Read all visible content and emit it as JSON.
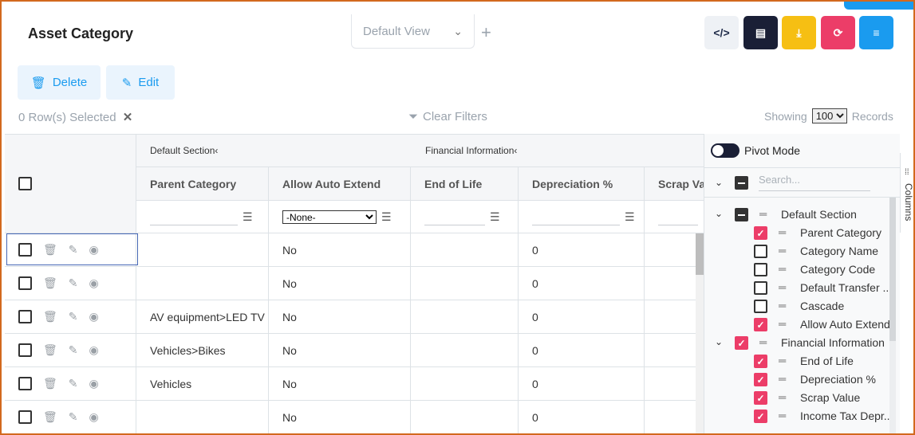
{
  "header": {
    "title": "Asset Category",
    "view_select": "Default View",
    "add_view": "+"
  },
  "toolbar": {
    "code_icon": "</>",
    "pdf_icon": "▤",
    "download_icon": "⤓",
    "refresh_icon": "⟳",
    "settings_icon": "≡"
  },
  "actions": {
    "delete_label": "Delete",
    "edit_label": "Edit"
  },
  "status": {
    "rows_selected": "0 Row(s) Selected",
    "clear_x": "✕",
    "clear_filters": "Clear Filters",
    "showing_label": "Showing",
    "page_size": "100",
    "records_label": "Records"
  },
  "grid": {
    "groups": {
      "default_section": "Default Section",
      "financial_information": "Financial Information"
    },
    "columns": {
      "parent_category": "Parent Category",
      "allow_auto_extend": "Allow Auto Extend",
      "end_of_life": "End of Life",
      "depreciation": "Depreciation %",
      "scrap_value": "Scrap Value"
    },
    "allow_filter_value": "-None-",
    "rows": [
      {
        "parent": "",
        "allow": "No",
        "depr": "0"
      },
      {
        "parent": "",
        "allow": "No",
        "depr": "0"
      },
      {
        "parent": "AV equipment>LED TV",
        "allow": "No",
        "depr": "0"
      },
      {
        "parent": "Vehicles>Bikes",
        "allow": "No",
        "depr": "0"
      },
      {
        "parent": "Vehicles",
        "allow": "No",
        "depr": "0"
      },
      {
        "parent": "",
        "allow": "No",
        "depr": "0"
      }
    ]
  },
  "column_panel": {
    "pivot_mode": "Pivot Mode",
    "search_placeholder": "Search...",
    "tab_label": "Columns",
    "items": [
      {
        "label": "Default Section",
        "state": "indeterminate",
        "group": true
      },
      {
        "label": "Parent Category",
        "state": "checked",
        "group": false
      },
      {
        "label": "Category Name",
        "state": "unchecked",
        "group": false
      },
      {
        "label": "Category Code",
        "state": "unchecked",
        "group": false
      },
      {
        "label": "Default Transfer ...",
        "state": "unchecked",
        "group": false
      },
      {
        "label": "Cascade",
        "state": "unchecked",
        "group": false
      },
      {
        "label": "Allow Auto Extend",
        "state": "checked",
        "group": false
      },
      {
        "label": "Financial Information",
        "state": "checked",
        "group": true
      },
      {
        "label": "End of Life",
        "state": "checked",
        "group": false
      },
      {
        "label": "Depreciation %",
        "state": "checked",
        "group": false
      },
      {
        "label": "Scrap Value",
        "state": "checked",
        "group": false
      },
      {
        "label": "Income Tax Depr...",
        "state": "checked",
        "group": false
      }
    ]
  }
}
